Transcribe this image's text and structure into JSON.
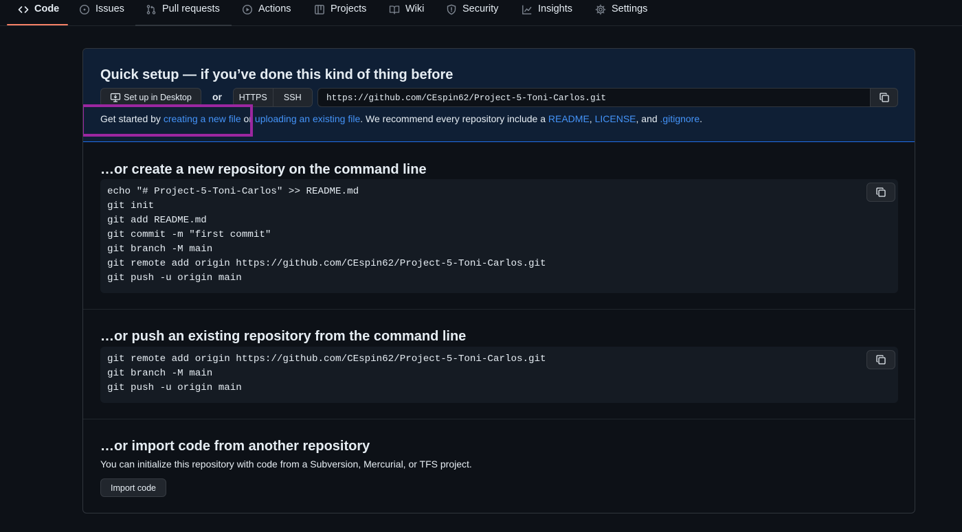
{
  "nav": {
    "tabs": [
      {
        "label": "Code",
        "icon": "code-icon",
        "selected": true
      },
      {
        "label": "Issues",
        "icon": "issue-icon"
      },
      {
        "label": "Pull requests",
        "icon": "pull-request-icon"
      },
      {
        "label": "Actions",
        "icon": "play-icon"
      },
      {
        "label": "Projects",
        "icon": "table-icon"
      },
      {
        "label": "Wiki",
        "icon": "book-icon"
      },
      {
        "label": "Security",
        "icon": "shield-icon"
      },
      {
        "label": "Insights",
        "icon": "graph-icon"
      },
      {
        "label": "Settings",
        "icon": "gear-icon"
      }
    ]
  },
  "quick_setup": {
    "title": "Quick setup — if you’ve done this kind of thing before",
    "desktop_button": "Set up in Desktop",
    "or": "or",
    "protocols": [
      "HTTPS",
      "SSH"
    ],
    "clone_url": "https://github.com/CEspin62/Project-5-Toni-Carlos.git",
    "get_started": {
      "prefix": "Get started by ",
      "link_new_file": "creating a new file",
      "middle": " or ",
      "link_upload": "uploading an existing file",
      "recommend": ". We recommend every repository include a ",
      "link_readme": "README",
      "comma": ", ",
      "link_license": "LICENSE",
      "and": ", and ",
      "link_gitignore": ".gitignore",
      "period": "."
    }
  },
  "create_section": {
    "title": "…or create a new repository on the command line",
    "lines": [
      "echo \"# Project-5-Toni-Carlos\" >> README.md",
      "git init",
      "git add README.md",
      "git commit -m \"first commit\"",
      "git branch -M main",
      "git remote add origin https://github.com/CEspin62/Project-5-Toni-Carlos.git",
      "git push -u origin main"
    ]
  },
  "push_section": {
    "title": "…or push an existing repository from the command line",
    "lines": [
      "git remote add origin https://github.com/CEspin62/Project-5-Toni-Carlos.git",
      "git branch -M main",
      "git push -u origin main"
    ]
  },
  "import_section": {
    "title": "…or import code from another repository",
    "description": "You can initialize this repository with code from a Subversion, Mercurial, or TFS project.",
    "button": "Import code"
  },
  "colors": {
    "background": "#0d1117",
    "quick_setup_bg": "#0f1f35",
    "link": "#4493f8",
    "selected_tab_underline": "#f78166",
    "highlight_box": "#9b27a0"
  }
}
